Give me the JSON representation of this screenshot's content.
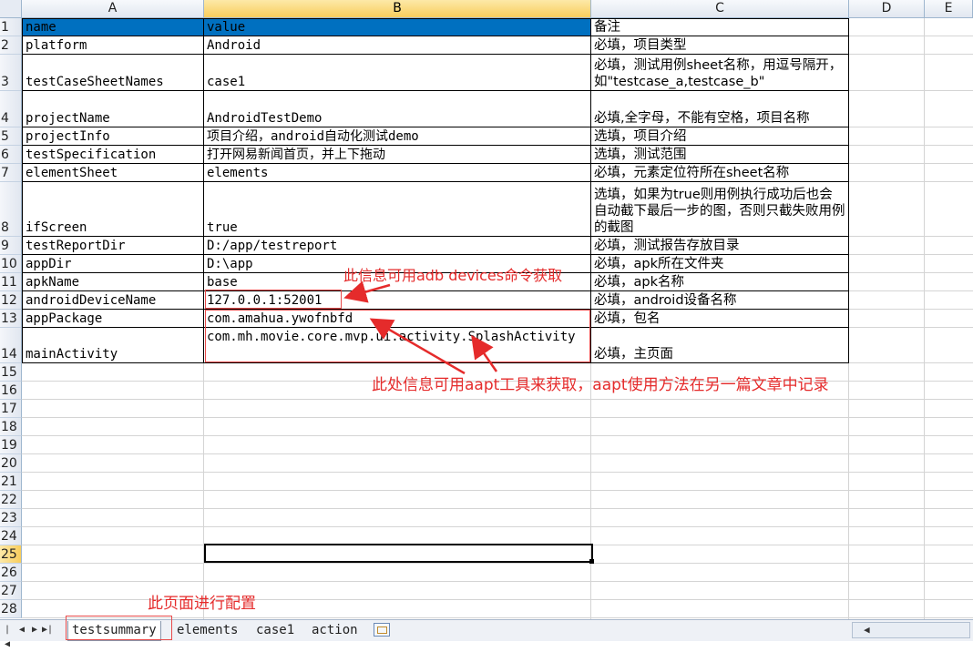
{
  "columns": [
    "A",
    "B",
    "C",
    "D",
    "E"
  ],
  "rows": [
    {
      "num": "1",
      "a": "name",
      "b": "value",
      "c": "备注"
    },
    {
      "num": "2",
      "a": "platform",
      "b": "Android",
      "c": "必填，项目类型"
    },
    {
      "num": "3",
      "a": "testCaseSheetNames",
      "b": "case1",
      "c": "必填，测试用例sheet名称，用逗号隔开，如\"testcase_a,testcase_b\""
    },
    {
      "num": "4",
      "a": "projectName",
      "b": "AndroidTestDemo",
      "c": "必填,全字母，不能有空格，项目名称"
    },
    {
      "num": "5",
      "a": "projectInfo",
      "b": "项目介绍，android自动化测试demo",
      "c": "选填，项目介绍"
    },
    {
      "num": "6",
      "a": "testSpecification",
      "b": "打开网易新闻首页，并上下拖动",
      "c": "选填，测试范围"
    },
    {
      "num": "7",
      "a": "elementSheet",
      "b": "elements",
      "c": "必填，元素定位符所在sheet名称"
    },
    {
      "num": "8",
      "a": "ifScreen",
      "b": "true",
      "c": "选填，如果为true则用例执行成功后也会自动截下最后一步的图，否则只截失败用例的截图"
    },
    {
      "num": "9",
      "a": "testReportDir",
      "b": "D:/app/testreport",
      "c": "必填，测试报告存放目录"
    },
    {
      "num": "10",
      "a": "appDir",
      "b": "D:\\app",
      "c": "必填，apk所在文件夹"
    },
    {
      "num": "11",
      "a": "apkName",
      "b": "base",
      "c": "必填，apk名称"
    },
    {
      "num": "12",
      "a": "androidDeviceName",
      "b": "127.0.0.1:52001",
      "c": "必填，android设备名称"
    },
    {
      "num": "13",
      "a": "appPackage",
      "b": "com.amahua.ywofnbfd",
      "c": "必填，包名"
    },
    {
      "num": "14",
      "a": "mainActivity",
      "b": "com.mh.movie.core.mvp.ui.activity.SplashActivity",
      "c": "必填，主页面"
    }
  ],
  "empty_rows": [
    "15",
    "16",
    "17",
    "18",
    "19",
    "20",
    "21",
    "22",
    "23",
    "24",
    "25",
    "26",
    "27",
    "28"
  ],
  "annotations": {
    "adb": "此信息可用adb devices命令获取",
    "aapt": "此处信息可用aapt工具来获取，aapt使用方法在另一篇文章中记录",
    "config": "此页面进行配置"
  },
  "sheet_tabs": [
    "testsummary",
    "elements",
    "case1",
    "action"
  ],
  "colors": {
    "header_fill": "#0070c0",
    "annotation": "#e52b2b",
    "selected_header": "#f8cd5c"
  }
}
